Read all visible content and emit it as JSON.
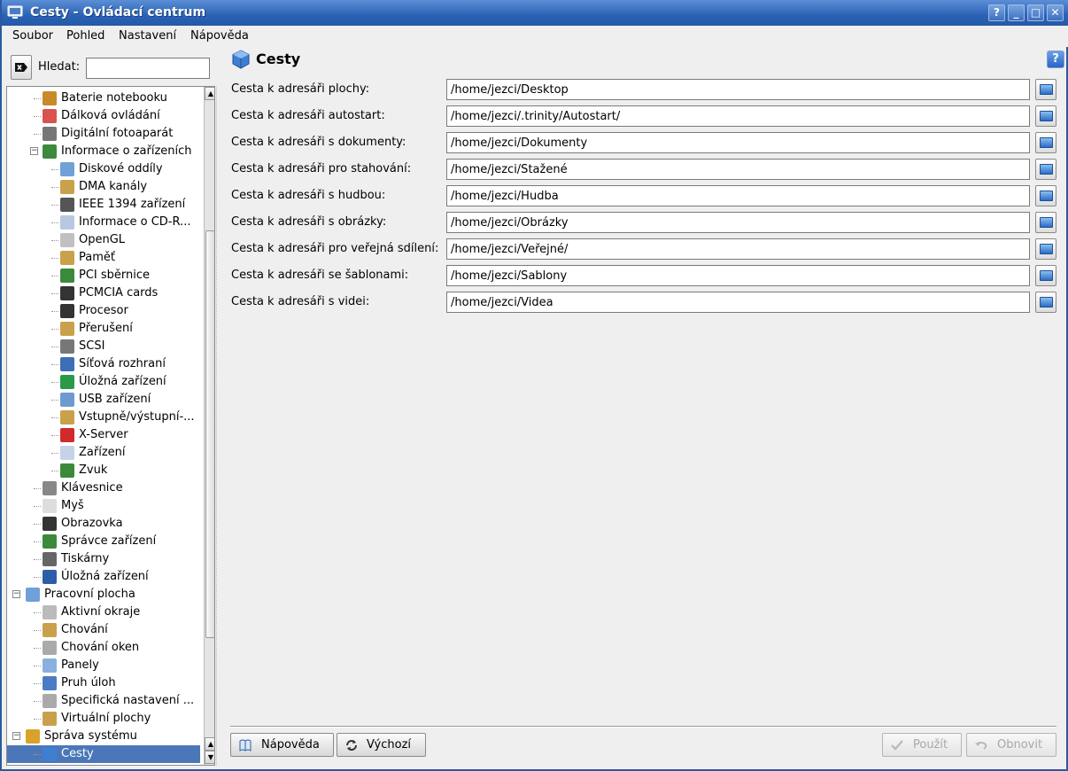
{
  "window": {
    "title": "Cesty - Ovládací centrum",
    "controls": {
      "help": "?",
      "minimize": "_",
      "maximize": "□",
      "close": "✕"
    }
  },
  "menubar": {
    "items": [
      {
        "label": "Soubor",
        "mnemonic": "S"
      },
      {
        "label": "Pohled",
        "mnemonic": "h"
      },
      {
        "label": "Nastavení",
        "mnemonic": "v"
      },
      {
        "label": "Nápověda",
        "mnemonic": "v"
      }
    ]
  },
  "search": {
    "label": "Hledat:",
    "value": "",
    "placeholder": ""
  },
  "tree": {
    "items": [
      {
        "label": "Baterie notebooku",
        "icon": "battery-icon"
      },
      {
        "label": "Dálková ovládání",
        "icon": "remote-icon"
      },
      {
        "label": "Digitální fotoaparát",
        "icon": "camera-icon"
      },
      {
        "label": "Informace o zařízeních",
        "icon": "info-icon"
      },
      {
        "label": "Diskové oddíly",
        "icon": "partition-icon"
      },
      {
        "label": "DMA kanály",
        "icon": "dma-icon"
      },
      {
        "label": "IEEE 1394 zařízení",
        "icon": "firewire-icon"
      },
      {
        "label": "Informace o CD-R...",
        "icon": "cdrom-icon"
      },
      {
        "label": "OpenGL",
        "icon": "opengl-icon"
      },
      {
        "label": "Paměť",
        "icon": "memory-icon"
      },
      {
        "label": "PCI sběrnice",
        "icon": "pci-icon"
      },
      {
        "label": "PCMCIA cards",
        "icon": "pcmcia-icon"
      },
      {
        "label": "Procesor",
        "icon": "cpu-icon"
      },
      {
        "label": "Přerušení",
        "icon": "interrupt-icon"
      },
      {
        "label": "SCSI",
        "icon": "scsi-icon"
      },
      {
        "label": "Síťová rozhraní",
        "icon": "network-icon"
      },
      {
        "label": "Úložná zařízení",
        "icon": "storage-icon"
      },
      {
        "label": "USB zařízení",
        "icon": "usb-icon"
      },
      {
        "label": "Vstupně/výstupní-...",
        "icon": "io-icon"
      },
      {
        "label": "X-Server",
        "icon": "xserver-icon"
      },
      {
        "label": "Zařízení",
        "icon": "device-icon"
      },
      {
        "label": "Zvuk",
        "icon": "sound-icon"
      },
      {
        "label": "Klávesnice",
        "icon": "keyboard-icon"
      },
      {
        "label": "Myš",
        "icon": "mouse-icon"
      },
      {
        "label": "Obrazovka",
        "icon": "display-icon"
      },
      {
        "label": "Správce zařízení",
        "icon": "device-manager-icon"
      },
      {
        "label": "Tiskárny",
        "icon": "printer-icon"
      },
      {
        "label": "Úložná zařízení",
        "icon": "storage-icon"
      },
      {
        "label": "Pracovní plocha",
        "icon": "desktop-icon"
      },
      {
        "label": "Aktivní okraje",
        "icon": "borders-icon"
      },
      {
        "label": "Chování",
        "icon": "behavior-icon"
      },
      {
        "label": "Chování oken",
        "icon": "window-behavior-icon"
      },
      {
        "label": "Panely",
        "icon": "panels-icon"
      },
      {
        "label": "Pruh úloh",
        "icon": "taskbar-icon"
      },
      {
        "label": "Specifická nastavení ...",
        "icon": "window-specific-icon"
      },
      {
        "label": "Virtuální plochy",
        "icon": "virtual-desktops-icon"
      },
      {
        "label": "Správa systému",
        "icon": "system-admin-icon"
      },
      {
        "label": "Cesty",
        "icon": "paths-icon"
      }
    ]
  },
  "module": {
    "title": "Cesty",
    "icon": "paths-icon"
  },
  "paths": [
    {
      "label": "Cesta k adresáři plochy:",
      "value": "/home/jezci/Desktop"
    },
    {
      "label": "Cesta k adresáři autostart:",
      "value": "/home/jezci/.trinity/Autostart/"
    },
    {
      "label": "Cesta k adresáři s dokumenty:",
      "value": "/home/jezci/Dokumenty"
    },
    {
      "label": "Cesta k adresáři pro stahování:",
      "value": "/home/jezci/Stažené"
    },
    {
      "label": "Cesta k adresáři s hudbou:",
      "value": "/home/jezci/Hudba"
    },
    {
      "label": "Cesta k adresáři s obrázky:",
      "value": "/home/jezci/Obrázky"
    },
    {
      "label": "Cesta k adresáři pro veřejná sdílení:",
      "value": "/home/jezci/Veřejné/"
    },
    {
      "label": "Cesta k adresáři se šablonami:",
      "value": "/home/jezci/Šablony"
    },
    {
      "label": "Cesta k adresáři s videi:",
      "value": "/home/jezci/Videa"
    }
  ],
  "buttons": {
    "help": "Nápověda",
    "defaults": "Výchozí",
    "apply": "Použít",
    "reset": "Obnovit"
  },
  "colors": {
    "titlebar": "#2a62b4",
    "selection": "#4b77b8",
    "background": "#efefef"
  }
}
